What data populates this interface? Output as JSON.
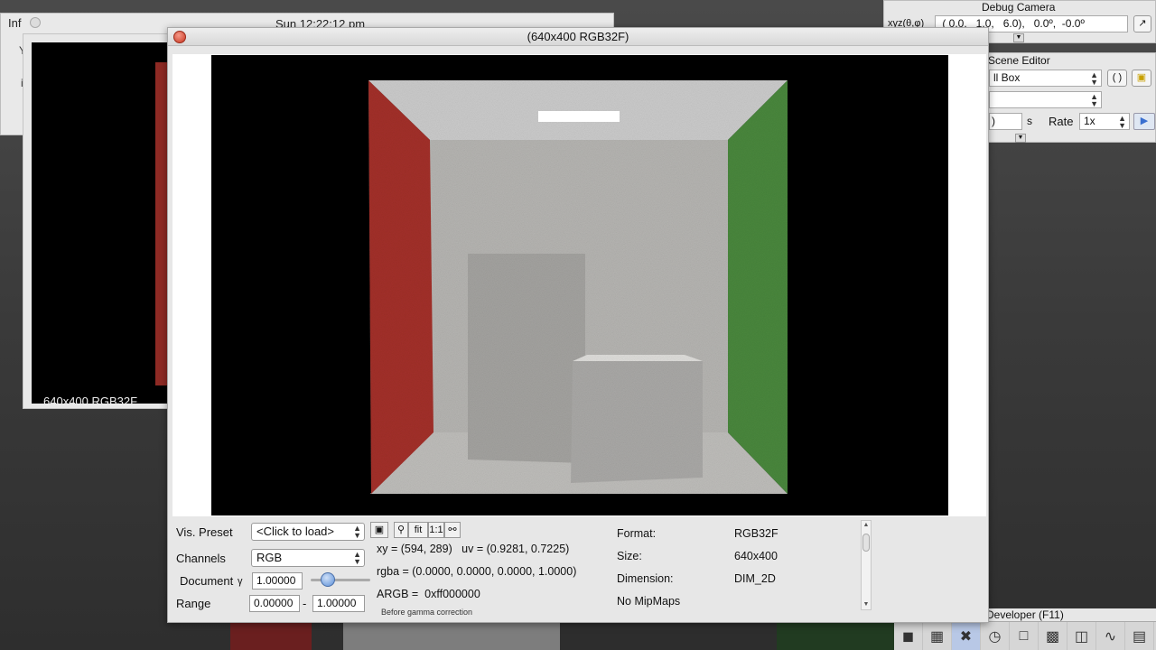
{
  "info_window": {
    "title": "Inf",
    "clock": "Sun 12:22:12 pm",
    "marks": [
      "Y",
      "i"
    ]
  },
  "thumbnail": {
    "label": "640x400 RGB32F"
  },
  "debug_camera": {
    "title": "Debug Camera",
    "field_label": "xyz(θ,φ)",
    "field_value": " ( 0.0,   1.0,   6.0),   0.0º,  -0.0º"
  },
  "scene_editor": {
    "title": "Scene Editor",
    "scene_select": "ll Box",
    "second_select": "",
    "time_value": ")",
    "seconds_unit": "s",
    "rate_label": "Rate",
    "rate_value": "1x"
  },
  "developer": {
    "label": "Developer (F11)",
    "dock_icons": [
      "camera-icon",
      "film-icon",
      "tools-icon",
      "clock-icon",
      "note-icon",
      "terminal-icon",
      "windows-icon",
      "graph-icon",
      "document-icon"
    ]
  },
  "viewer": {
    "title": "(640x400 RGB32F)",
    "vis_preset_label": "Vis. Preset",
    "vis_preset_value": "<Click to load>",
    "channels_label": "Channels",
    "channels_value": "RGB",
    "document_label": "Document",
    "gamma_symbol": "γ",
    "gamma_value": "1.00000",
    "gamma_slider": 0.2,
    "range_label": "Range",
    "range_min": "0.00000",
    "range_separator": "-",
    "range_max": "1.00000",
    "tools": {
      "save_glyph": "▣",
      "fit_label": "fit",
      "one_to_one_label": "1:1"
    },
    "xy_line": "xy = (594, 289)   uv = (0.9281, 0.7225)",
    "rgba_line": "rgba = (0.0000, 0.0000, 0.0000, 1.0000)",
    "argb_line": "ARGB =  0xff000000",
    "gamma_note": "Before gamma correction",
    "format_label": "Format:",
    "format_value": "RGB32F",
    "size_label": "Size:",
    "size_value": "640x400",
    "dimension_label": "Dimension:",
    "dimension_value": "DIM_2D",
    "mipmaps_text": "No MipMaps"
  },
  "colors": {
    "red_wall": "#a6312b",
    "green_wall": "#4b8a3e",
    "grey_wall": "#b7b6b3",
    "ceiling": "#c8c8c8"
  }
}
